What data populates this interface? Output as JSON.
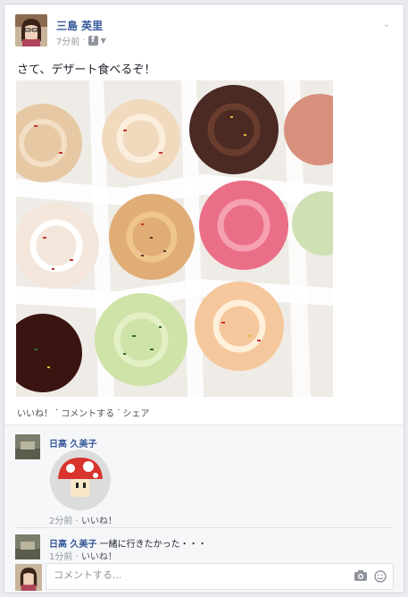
{
  "post": {
    "author": "三島 英里",
    "time": "7分前",
    "text": "さて、デザート食べるぞ！",
    "audience_icon": "facebook-icon",
    "menu_icon": "chevron-down-icon"
  },
  "actions": {
    "like": "いいね！",
    "comment": "コメントする",
    "share": "シェア",
    "sep": "·"
  },
  "comments": [
    {
      "author": "日高 久美子",
      "text": "",
      "sticker": "mushroom-sticker",
      "time": "2分前",
      "like": "いいね！"
    },
    {
      "author": "日高 久美子",
      "text": "一緒に行きたかった・・・",
      "time": "1分前",
      "like": "いいね！"
    }
  ],
  "composer": {
    "placeholder": "コメントする...",
    "camera_icon": "camera-icon",
    "emoji_icon": "smiley-icon"
  },
  "colors": {
    "link": "#365899",
    "meta": "#90949c",
    "background": "#e9ebee"
  }
}
